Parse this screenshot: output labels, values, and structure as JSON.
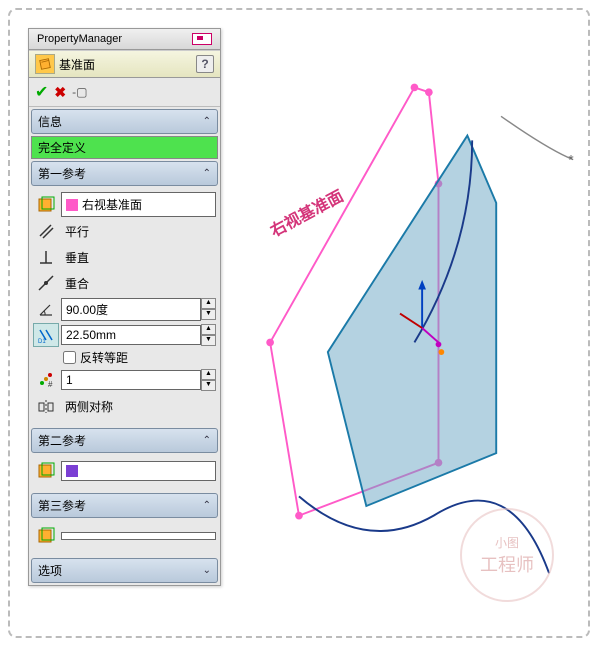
{
  "header": {
    "title": "PropertyManager"
  },
  "feature": {
    "name": "基准面",
    "help": "?"
  },
  "actions": {
    "ok": "✓",
    "cancel": "✕",
    "pin": "📌"
  },
  "sections": {
    "info": {
      "title": "信息",
      "status": "完全定义"
    },
    "ref1": {
      "title": "第一参考",
      "selected": "右视基准面",
      "parallel": "平行",
      "perpendicular": "垂直",
      "coincident": "重合",
      "angle": "90.00度",
      "distance": "22.50mm",
      "reverse": "反转等距",
      "count": "1",
      "symmetric": "两侧对称"
    },
    "ref2": {
      "title": "第二参考",
      "selected": ""
    },
    "ref3": {
      "title": "第三参考",
      "selected": ""
    },
    "options": {
      "title": "选项"
    }
  },
  "viewport": {
    "plane_label": "右视基准面"
  },
  "watermark": {
    "line1": "小图",
    "line2": "工程师"
  }
}
